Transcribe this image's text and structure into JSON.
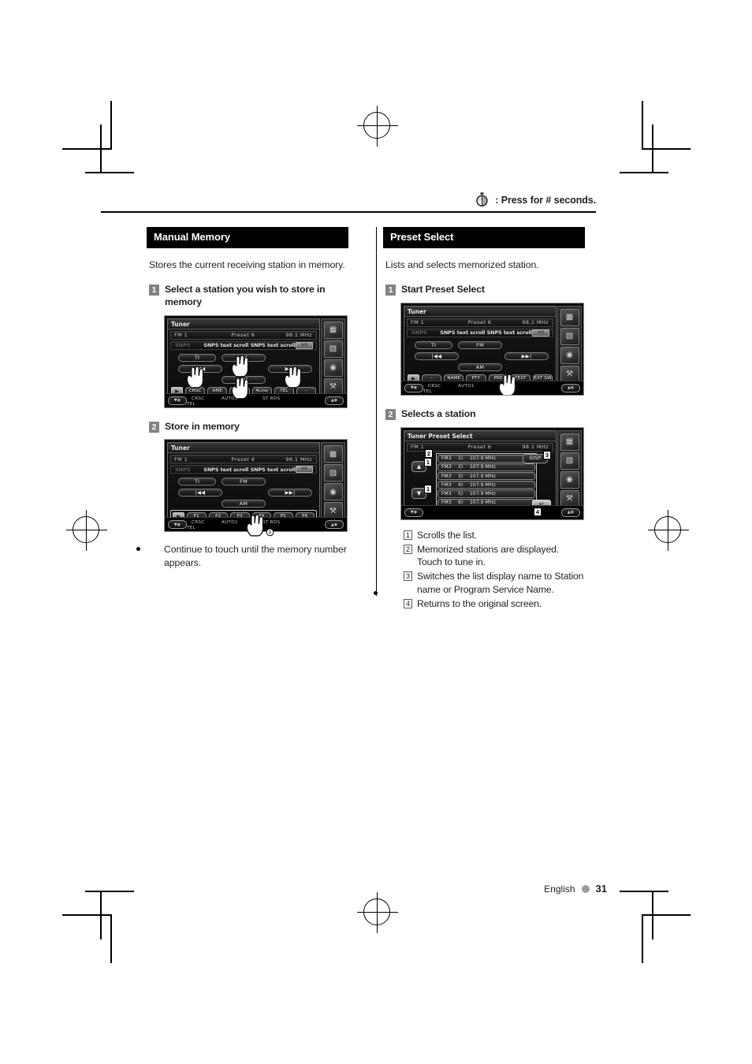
{
  "header": {
    "icon": "stopwatch-icon",
    "note": ": Press for # seconds."
  },
  "footer": {
    "language": "English",
    "page_number": "31"
  },
  "left_column": {
    "section_title": "Manual Memory",
    "intro": "Stores the current receiving station in memory.",
    "steps": [
      {
        "num": "1",
        "text": "Select a station you wish to store in memory"
      },
      {
        "num": "2",
        "text": "Store in memory"
      }
    ],
    "note": "Continue to touch until the memory number appears.",
    "screen1": {
      "title": "Tuner",
      "band": "FM 1",
      "preset": "Preset 6",
      "freq": "98.1  MHz",
      "ps_label": "SNPS",
      "scroll_text": "SNPS text scroll SNPS text scroll",
      "text_badge": "4/6",
      "controls": {
        "ti": "TI",
        "fm": "FM",
        "prev": "|◀◀",
        "next": "▶▶|",
        "am": "AM"
      },
      "buttons": [
        "CRSC",
        "AME",
        "SEEK",
        "4Line",
        "TEL",
        "-"
      ],
      "arrow_label": "▶",
      "status": {
        "left": "CRSC",
        "mid": "AUTO1",
        "right": "ST  RDS",
        "tel": "TEL"
      }
    },
    "screen2": {
      "title": "Tuner",
      "band": "FM 1",
      "preset": "Preset 6",
      "freq": "98.1  MHz",
      "ps_label": "SNPS",
      "scroll_text": "SNPS text scroll SNPS text scroll",
      "text_badge": "4/6",
      "controls": {
        "ti": "TI",
        "fm": "FM",
        "prev": "|◀◀",
        "next": "▶▶|",
        "am": "AM"
      },
      "buttons": [
        "P1",
        "P2",
        "P3",
        "P4",
        "P5",
        "P6"
      ],
      "arrow_label": "▶",
      "status": {
        "left": "CRSC",
        "mid": "AUTO1",
        "right": "ST  RDS",
        "tel": "TEL"
      },
      "hold_badge": "2"
    }
  },
  "right_column": {
    "section_title": "Preset Select",
    "intro": "Lists and selects memorized station.",
    "steps": [
      {
        "num": "1",
        "text": "Start Preset Select"
      },
      {
        "num": "2",
        "text": "Selects a station"
      }
    ],
    "notes": [
      {
        "num": "1",
        "text": "Scrolls the list."
      },
      {
        "num": "2",
        "text": "Memorized stations are displayed. Touch to tune in."
      },
      {
        "num": "3",
        "text": "Switches the list display name to Station name or Program Service Name."
      },
      {
        "num": "4",
        "text": "Returns to the original screen."
      }
    ],
    "screen1": {
      "title": "Tuner",
      "band": "FM 1",
      "preset": "Preset 6",
      "freq": "98.1  MHz",
      "ps_label": "SNPS",
      "scroll_text": "SNPS text scroll SNPS text scroll",
      "text_badge": "4/6",
      "controls": {
        "ti": "TI",
        "fm": "FM",
        "prev": "|◀◀",
        "next": "▶▶|",
        "am": "AM"
      },
      "buttons": [
        "-",
        "NAME",
        "PTY",
        "PRE",
        "TEXT",
        "EXT SW"
      ],
      "arrow_label": "▶",
      "status": {
        "left": "CRSC",
        "mid": "AUTO1",
        "right": "ST  RDS",
        "tel": "TEL"
      }
    },
    "screen2": {
      "title": "Tuner Preset Select",
      "band": "FM  1",
      "preset": "Preset 6",
      "freq": "98.1  MHz",
      "scroll_up": "▲",
      "scroll_down": "▼",
      "disp_label": "DISP",
      "return_label": "↵",
      "list": [
        {
          "band": "FM3",
          "index": "1)",
          "freq": "107.9  MHz"
        },
        {
          "band": "FM3",
          "index": "2)",
          "freq": "107.9  MHz"
        },
        {
          "band": "FM3",
          "index": "3)",
          "freq": "107.9  MHz"
        },
        {
          "band": "FM3",
          "index": "4)",
          "freq": "107.9  MHz"
        },
        {
          "band": "FM3",
          "index": "5)",
          "freq": "107.9  MHz"
        },
        {
          "band": "FM3",
          "index": "6)",
          "freq": "107.9  MHz"
        }
      ],
      "callouts": {
        "up": "1",
        "down": "1",
        "list": "2",
        "disp": "3",
        "return": "4"
      }
    }
  }
}
